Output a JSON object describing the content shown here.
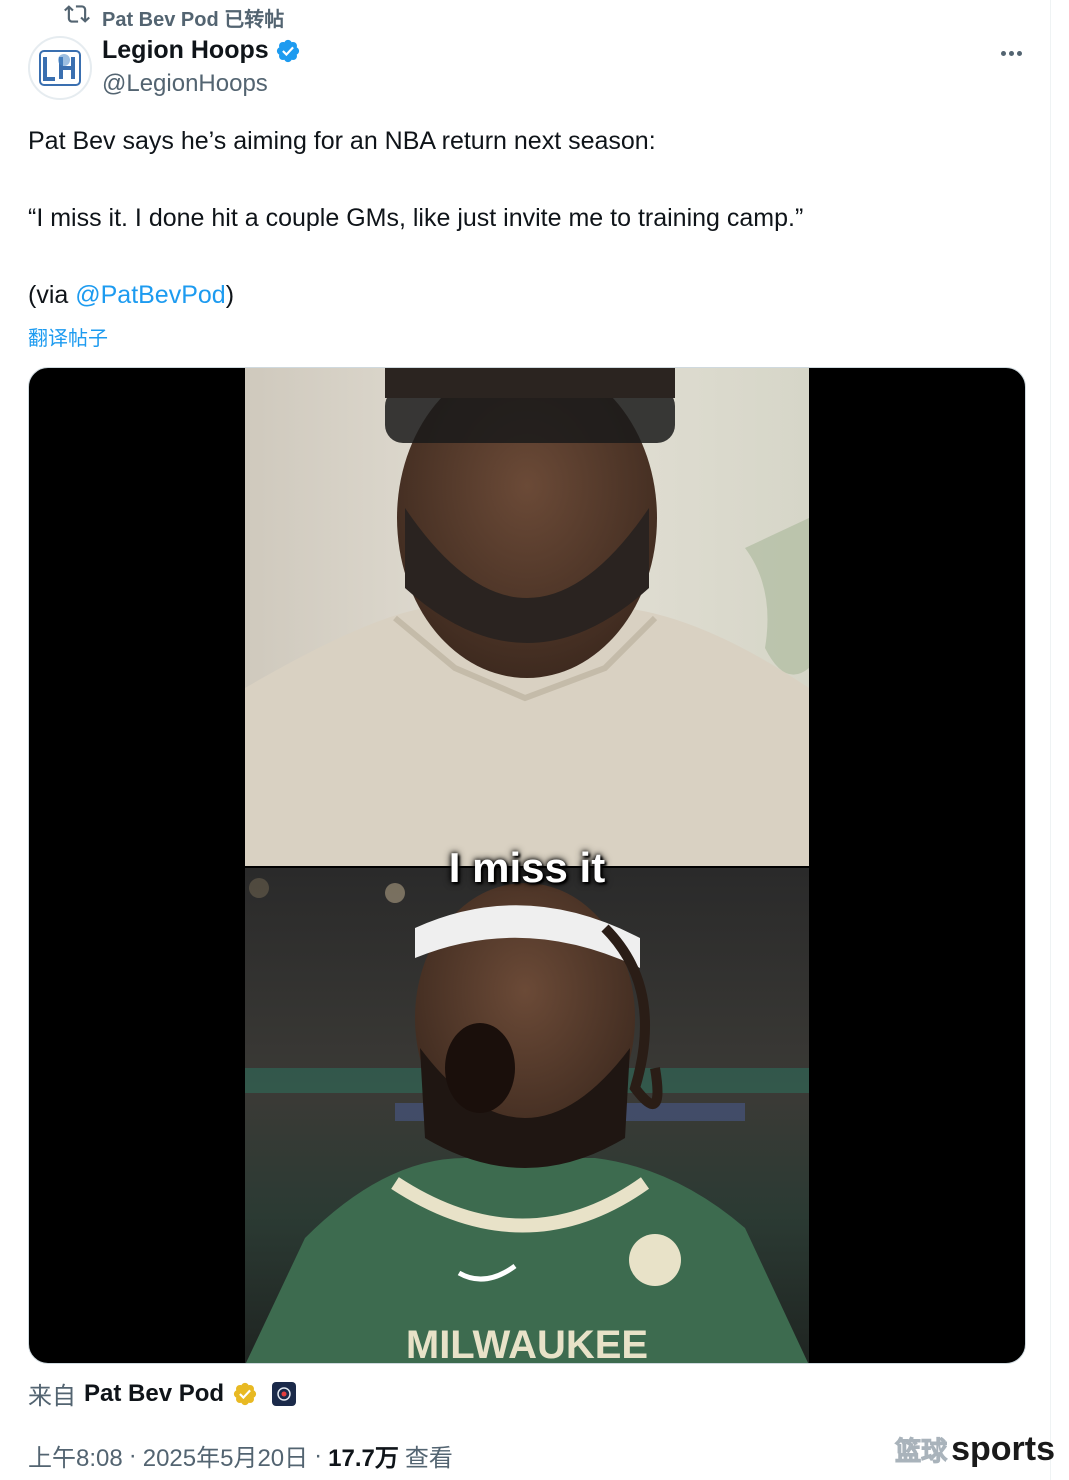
{
  "repost": {
    "label": "Pat Bev Pod 已转帖",
    "icon": "repost-icon"
  },
  "author": {
    "name": "Legion Hoops",
    "handle": "@LegionHoops",
    "verified": true,
    "verified_color": "#1d9bf0"
  },
  "tweet": {
    "line1": "Pat Bev says he’s aiming for an NBA return next season:",
    "line2": "“I miss it. I done hit a couple GMs, like just invite me to training camp.”",
    "via_prefix": "(via ",
    "via_link": "@PatBevPod",
    "via_suffix": ")",
    "translate_label": "翻译帖子"
  },
  "media": {
    "caption": "I miss it"
  },
  "source": {
    "prefix": "来自",
    "name": "Pat Bev Pod",
    "badge_color": "#e8b923"
  },
  "meta": {
    "time": "上午8:08",
    "sep1": "·",
    "date": "2025年5月20日",
    "sep2": "·",
    "views": "17.7万",
    "views_label": "查看"
  },
  "watermark": {
    "cn": "篮球",
    "en": "sports"
  },
  "colors": {
    "link": "#1d9bf0",
    "secondary_text": "#536471",
    "primary_text": "#0f1419"
  }
}
